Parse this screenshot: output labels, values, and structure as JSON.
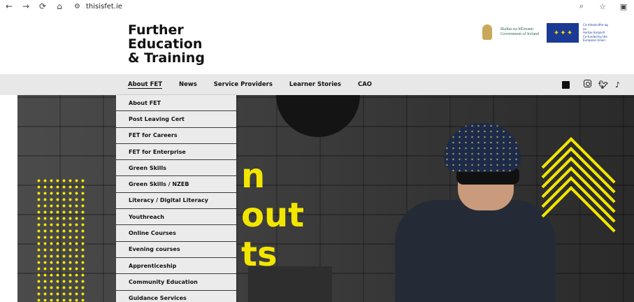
{
  "browser": {
    "back": "←",
    "forward": "→",
    "reload": "⟳",
    "home": "⌂",
    "url": "thisisfet.ie",
    "zoom_icon": "zoom-icon",
    "star_icon": "star-icon"
  },
  "header": {
    "logo_line1": "Further",
    "logo_line2": "Education",
    "logo_line3": "& Training",
    "gov_line1": "Rialtas na hÉireann",
    "gov_line2": "Government of Ireland",
    "eu_line1": "Co-mhaoinithe ag an",
    "eu_line2": "Aontas Eorpach",
    "eu_line3": "Co-funded by the",
    "eu_line4": "European Union"
  },
  "nav": {
    "items": [
      "About FET",
      "News",
      "Service Providers",
      "Learner Stories",
      "CAO"
    ]
  },
  "social": {
    "icons": [
      "facebook-icon",
      "instagram-icon",
      "twitter-icon",
      "tiktok-icon"
    ]
  },
  "hero": {
    "line1": "n",
    "line2": "out",
    "line3": "ts"
  },
  "dropdown": {
    "items": [
      "About FET",
      "Post Leaving Cert",
      "FET for Careers",
      "FET for Enterprise",
      "Green Skills",
      "Green Skills / NZEB",
      "Literacy / Digital Literacy",
      "Youthreach",
      "Online Courses",
      "Evening courses",
      "Apprenticeship",
      "Community Education",
      "Guidance Services"
    ]
  },
  "colors": {
    "accent_yellow": "#f2e600",
    "nav_bg": "#e8e8e8",
    "dropdown_bg": "#ebebeb"
  }
}
